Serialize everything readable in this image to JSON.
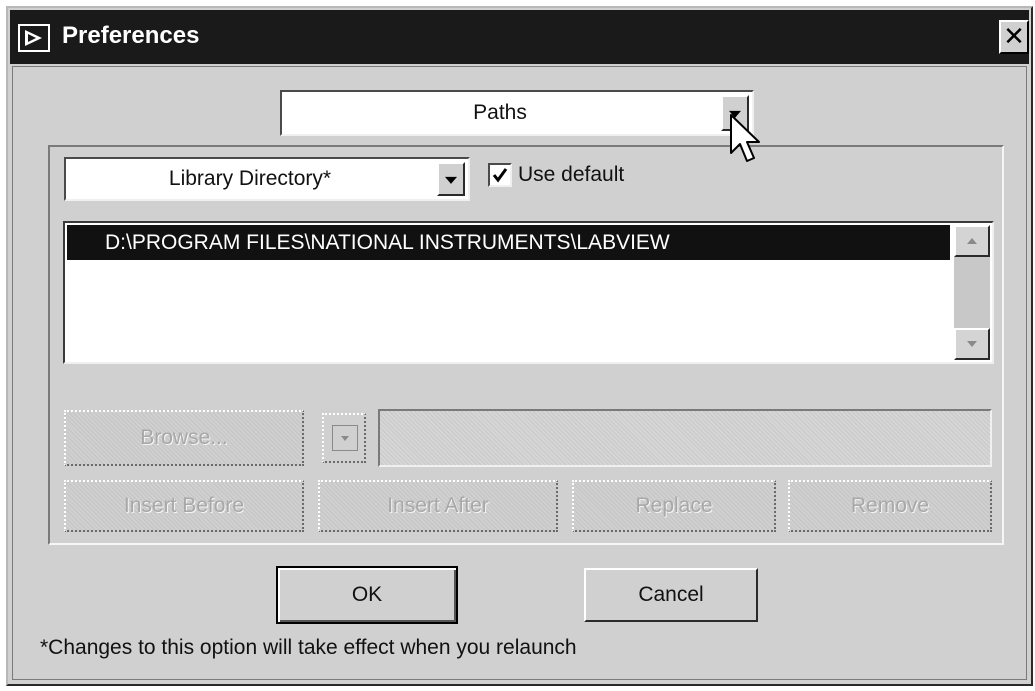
{
  "window": {
    "title": "Preferences",
    "close_glyph": "✕"
  },
  "category_select": {
    "value": "Paths"
  },
  "path_type_select": {
    "value": "Library Directory*"
  },
  "use_default": {
    "label": "Use default",
    "checked": true
  },
  "path_list": {
    "items": [
      "D:\\PROGRAM FILES\\NATIONAL INSTRUMENTS\\LABVIEW"
    ],
    "selected_index": 0
  },
  "path_editor": {
    "browse_label": "Browse...",
    "path_value": ""
  },
  "list_buttons": {
    "insert_before": "Insert Before",
    "insert_after": "Insert After",
    "replace": "Replace",
    "remove": "Remove"
  },
  "dialog_buttons": {
    "ok": "OK",
    "cancel": "Cancel"
  },
  "footnote": "*Changes to this option will take effect when you relaunch",
  "icons": {
    "app": "labview-run-arrow-icon",
    "close": "close-icon",
    "dropdown": "chevron-down-icon",
    "scroll_up": "scroll-up-arrow-icon",
    "scroll_down": "scroll-down-arrow-icon",
    "checkmark": "checkmark-icon",
    "cursor": "mouse-pointer-icon"
  },
  "colors": {
    "titlebar": "#1a1a1a",
    "dialog_bg": "#d0d0d0",
    "selection": "#111111"
  }
}
